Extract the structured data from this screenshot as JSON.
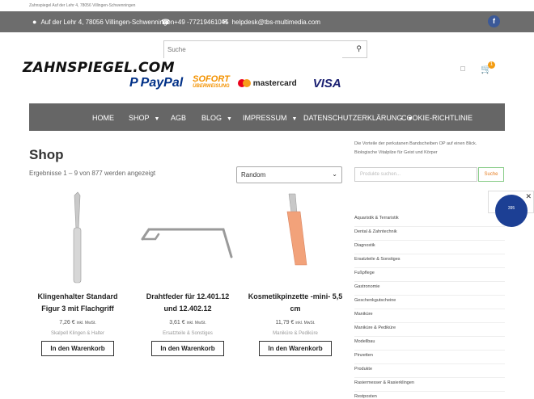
{
  "top_note": "Zahnspiegel Auf der Lehr 4, 78056 Villingen-Schwenningen",
  "topbar": {
    "address": "Auf der Lehr 4, 78056 Villingen-Schwenningen",
    "phone": "+49 -77219461045",
    "email": "helpdesk@tbs-multimedia.com",
    "fb": "f"
  },
  "search": {
    "placeholder": "Suche"
  },
  "logo": "ZAHNSPIEGEL.COM",
  "payments": {
    "paypal": "PayPal",
    "sofort": "SOFORT",
    "sofort_sub": "ÜBERWEISUNG",
    "mastercard": "mastercard",
    "visa": "VISA"
  },
  "cart": {
    "count": "1"
  },
  "nav": [
    {
      "label": "HOME"
    },
    {
      "label": "SHOP"
    },
    {
      "label": "AGB"
    },
    {
      "label": "BLOG"
    },
    {
      "label": "IMPRESSUM"
    },
    {
      "label": "DATENSCHUTZERKLÄRUNG"
    },
    {
      "label": "COOKIE-RICHTLINIE"
    }
  ],
  "shop": {
    "title": "Shop",
    "count": "Ergebnisse 1 – 9 von 877 werden angezeigt",
    "sort": "Random"
  },
  "products": [
    {
      "title": "Klingenhalter Standard Figur 3 mit Flachgriff",
      "price": "7,26 €",
      "tax": "inkl. MwSt.",
      "category": "Skalpell Klingen & Halter",
      "button": "In den Warenkorb"
    },
    {
      "title": "Drahtfeder für 12.401.12 und 12.402.12",
      "price": "3,61 €",
      "tax": "inkl. MwSt.",
      "category": "Ersatzteile & Sonstiges",
      "button": "In den Warenkorb"
    },
    {
      "title": "Kosmetikpinzette -mini- 5,5 cm",
      "price": "11,79 €",
      "tax": "inkl. MwSt.",
      "category": "Maniküre & Pediküre",
      "button": "In den Warenkorb"
    }
  ],
  "sidebar": {
    "line1": "Die Vorteile der perkutanen Bandscheiben OP auf einen Blick.",
    "line2": "Biologische Vitalpilze für Geist und Körper",
    "search_placeholder": "Produkte suchen...",
    "search_button": "Suche",
    "trust_score": "395",
    "categories": [
      "Aquaristik & Terraristik",
      "Dental & Zahntechnik",
      "Diagnostik",
      "Ersatzteile & Sonstiges",
      "Fußpflege",
      "Gastronomie",
      "Geschenkgutscheine",
      "Maniküre",
      "Maniküre & Pediküre",
      "Modellbau",
      "Pinzetten",
      "Produkte",
      "Rasiermesser & Rasierklingen",
      "Restposten"
    ]
  },
  "colors": {
    "topbar": "#6d6d6d",
    "nav": "#666666",
    "badge": "#f39c12",
    "accent": "#e67e22"
  }
}
